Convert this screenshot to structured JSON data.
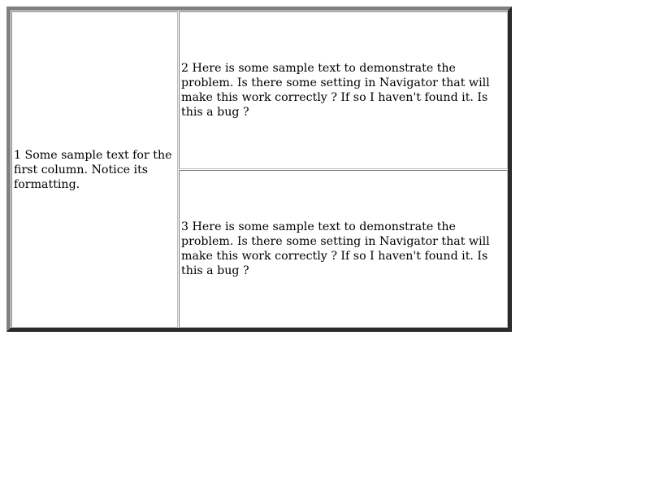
{
  "table": {
    "cells": [
      {
        "id": "1",
        "text": "1 Some sample text for the first column. Notice its formatting."
      },
      {
        "id": "2",
        "text": "2 Here is some sample text to demonstrate the problem. Is there some setting in Navigator that will make this work correctly ? If so I haven't found it. Is this a bug ?"
      },
      {
        "id": "3",
        "text": "3 Here is some sample text to demonstrate the problem. Is there some setting in Navigator that will make this work correctly ? If so I haven't found it. Is this a bug ?"
      }
    ]
  },
  "colors": {
    "page_background": "#ffffff",
    "outer_border_light": "#808080",
    "outer_border_dark": "#2b2b2b",
    "cell_border": "#7a7a7a",
    "text": "#000000"
  }
}
